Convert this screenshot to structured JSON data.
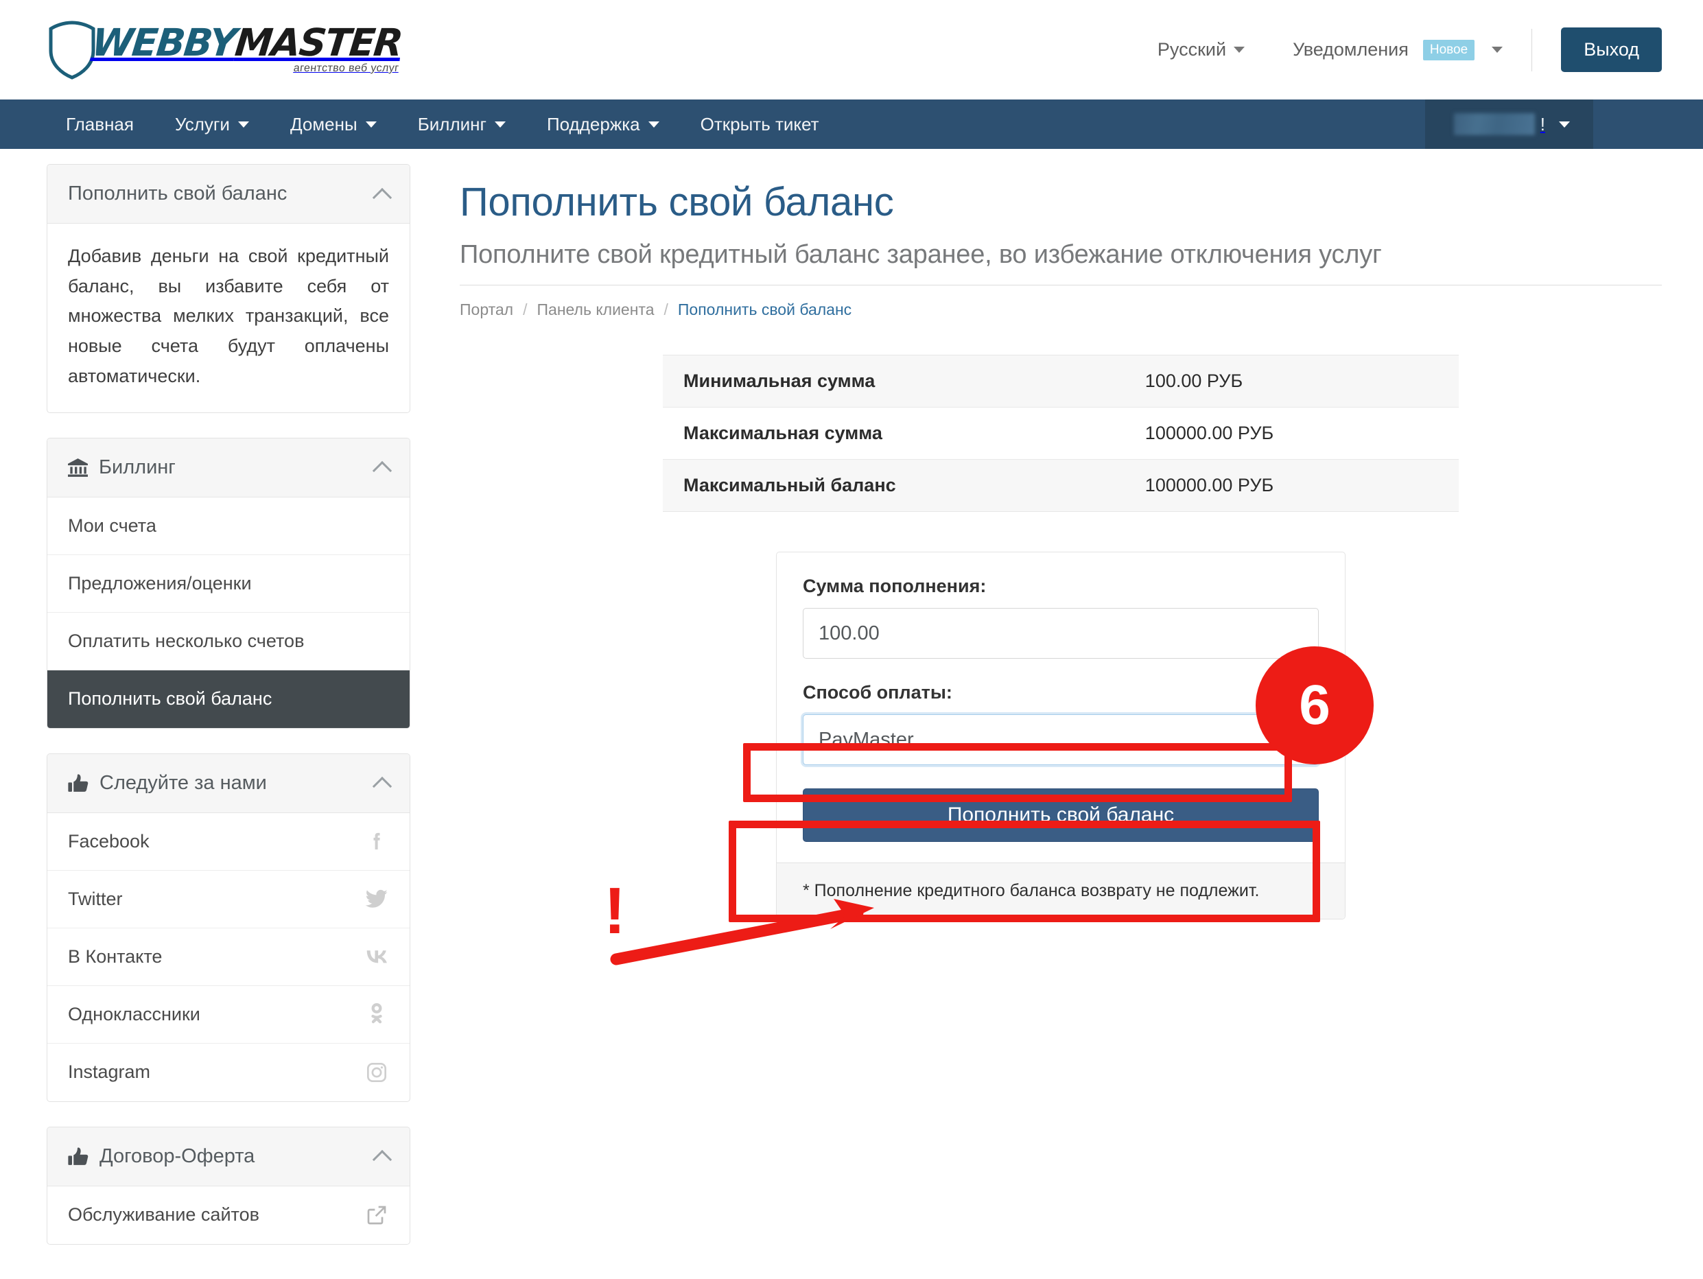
{
  "brand": {
    "name_part1": "WEBBY",
    "name_part2": "MASTER",
    "tagline": "агентство веб услуг"
  },
  "header": {
    "language": "Русский",
    "notifications": "Уведомления",
    "notifications_badge": "Новое",
    "logout": "Выход"
  },
  "nav": {
    "items": [
      {
        "label": "Главная",
        "has_caret": false
      },
      {
        "label": "Услуги",
        "has_caret": true
      },
      {
        "label": "Домены",
        "has_caret": true
      },
      {
        "label": "Биллинг",
        "has_caret": true
      },
      {
        "label": "Поддержка",
        "has_caret": true
      },
      {
        "label": "Открыть тикет",
        "has_caret": false
      }
    ],
    "user_suffix": "!"
  },
  "sidebar": {
    "panels": [
      {
        "title": "Пополнить свой баланс",
        "body": "Добавив деньги на свой кредитный баланс, вы избавите себя от множества мелких транзакций, все новые счета будут оплачены автоматически."
      },
      {
        "title": "Биллинг",
        "icon": "bank-icon",
        "items": [
          {
            "label": "Мои счета",
            "active": false,
            "icon": ""
          },
          {
            "label": "Предложения/оценки",
            "active": false,
            "icon": ""
          },
          {
            "label": "Оплатить несколько счетов",
            "active": false,
            "icon": ""
          },
          {
            "label": "Пополнить свой баланс",
            "active": true,
            "icon": ""
          }
        ]
      },
      {
        "title": "Следуйте за нами",
        "icon": "thumbs-up-icon",
        "items": [
          {
            "label": "Facebook",
            "active": false,
            "icon": "facebook-icon"
          },
          {
            "label": "Twitter",
            "active": false,
            "icon": "twitter-icon"
          },
          {
            "label": "В Контакте",
            "active": false,
            "icon": "vk-icon"
          },
          {
            "label": "Одноклассники",
            "active": false,
            "icon": "ok-icon"
          },
          {
            "label": "Instagram",
            "active": false,
            "icon": "instagram-icon"
          }
        ]
      },
      {
        "title": "Договор-Оферта",
        "icon": "thumbs-up-icon",
        "items": [
          {
            "label": "Обслуживание сайтов",
            "active": false,
            "icon": "external-link-icon"
          }
        ]
      }
    ]
  },
  "main": {
    "title": "Пополнить свой баланс",
    "subtitle": "Пополните свой кредитный баланс заранее, во избежание отключения услуг",
    "breadcrumb": [
      "Портал",
      "Панель клиента",
      "Пополнить свой баланс"
    ],
    "info_rows": [
      {
        "label": "Минимальная сумма",
        "value": "100.00 РУБ"
      },
      {
        "label": "Максимальная сумма",
        "value": "100000.00 РУБ"
      },
      {
        "label": "Максимальный баланс",
        "value": "100000.00 РУБ"
      }
    ],
    "form": {
      "amount_label": "Сумма пополнения:",
      "amount_value": "100.00",
      "amount_placeholder": "100.00",
      "method_label": "Способ оплаты:",
      "method_value": "PayMaster",
      "submit_label": "Пополнить свой баланс",
      "footnote": "* Пополнение кредитного баланса возврату не подлежит."
    }
  },
  "annotations": {
    "step_number": "6",
    "exclamation": "!",
    "color": "#ed1c16"
  }
}
